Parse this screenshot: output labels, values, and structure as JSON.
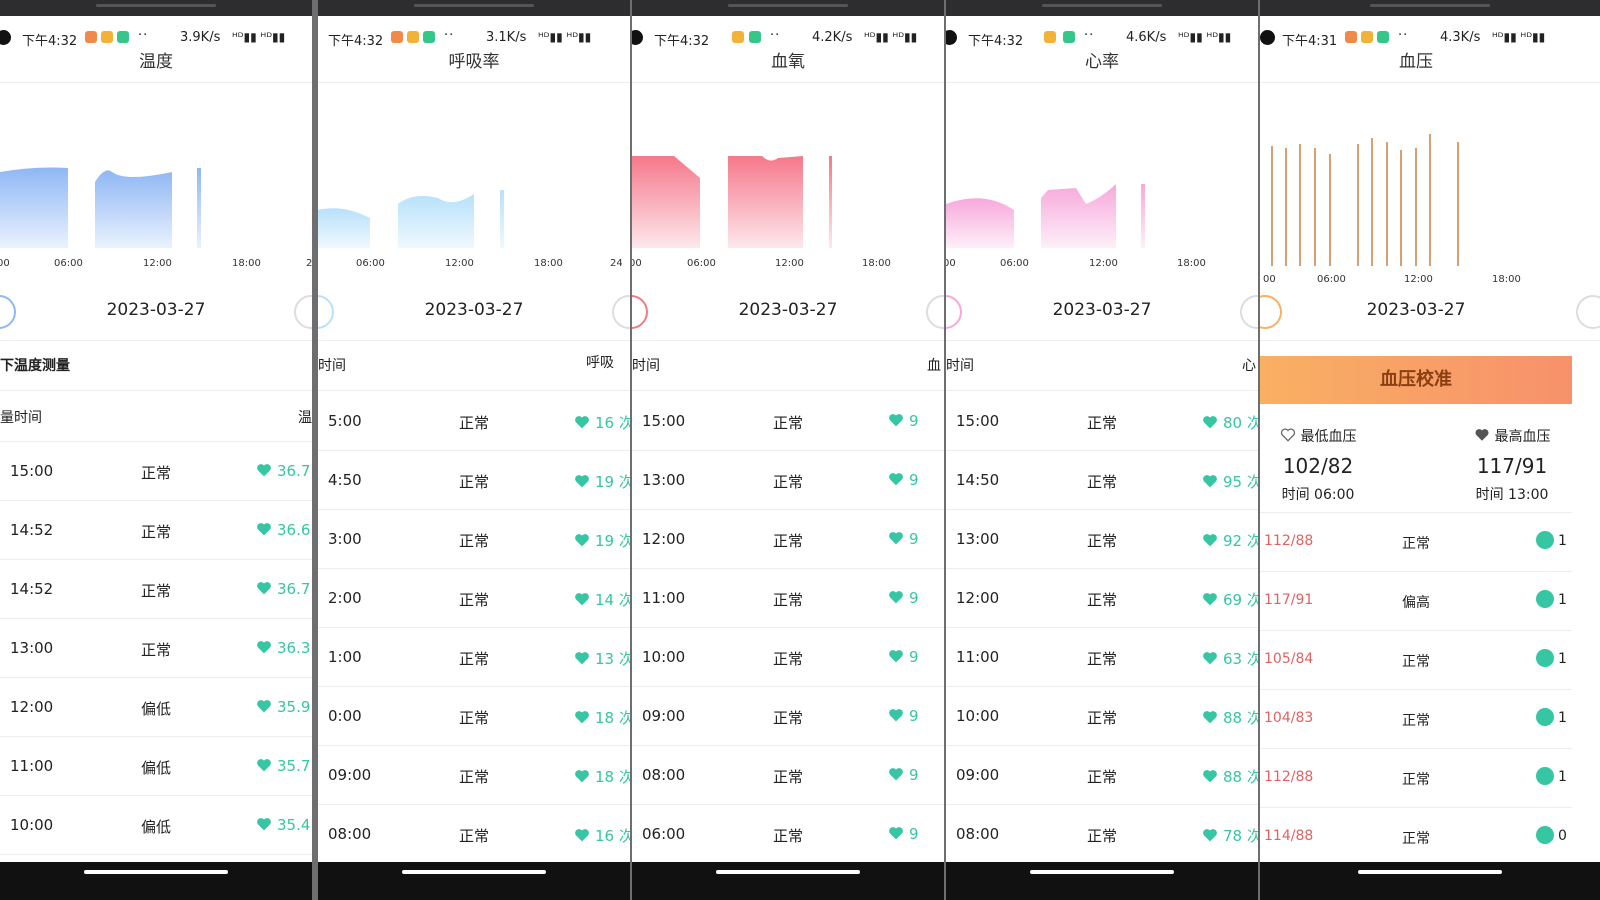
{
  "status": {
    "time": "下午4:32",
    "time_bp": "下午4:31",
    "dots": "··",
    "speeds": [
      "3.9K/s",
      "3.1K/s",
      "4.2K/s",
      "4.6K/s",
      "4.3K/s"
    ],
    "bt": "✱",
    "signal": "ᴴᴰ▮▮ ᴴᴰ▮▮"
  },
  "date": "2023-03-27",
  "xaxis": [
    "00",
    "06:00",
    "12:00",
    "18:00",
    "24"
  ],
  "heart_color": "#36c6a3",
  "temperature": {
    "title": "温度",
    "section_title": "下温度测量",
    "col_time": "量时间",
    "col_value": "温",
    "rows": [
      {
        "time": "15:00",
        "status": "正常",
        "value": "36.7"
      },
      {
        "time": "14:52",
        "status": "正常",
        "value": "36.6"
      },
      {
        "time": "14:52",
        "status": "正常",
        "value": "36.7"
      },
      {
        "time": "13:00",
        "status": "正常",
        "value": "36.3"
      },
      {
        "time": "12:00",
        "status": "偏低",
        "value": "35.9"
      },
      {
        "time": "11:00",
        "status": "偏低",
        "value": "35.7"
      },
      {
        "time": "10:00",
        "status": "偏低",
        "value": "35.4"
      }
    ]
  },
  "respiration": {
    "title": "呼吸率",
    "col_time": "时间",
    "col_value": "呼吸",
    "rows": [
      {
        "time": "5:00",
        "status": "正常",
        "value": "16 次/"
      },
      {
        "time": "4:50",
        "status": "正常",
        "value": "19 次/"
      },
      {
        "time": "3:00",
        "status": "正常",
        "value": "19 次/"
      },
      {
        "time": "2:00",
        "status": "正常",
        "value": "14 次/"
      },
      {
        "time": "1:00",
        "status": "正常",
        "value": "13 次/"
      },
      {
        "time": "0:00",
        "status": "正常",
        "value": "18 次/"
      },
      {
        "time": "09:00",
        "status": "正常",
        "value": "18 次/"
      },
      {
        "time": "08:00",
        "status": "正常",
        "value": "16 次/"
      }
    ]
  },
  "oxygen": {
    "title": "血氧",
    "col_time": "时间",
    "col_value": "血",
    "rows": [
      {
        "time": "15:00",
        "status": "正常",
        "value": "9"
      },
      {
        "time": "13:00",
        "status": "正常",
        "value": "9"
      },
      {
        "time": "12:00",
        "status": "正常",
        "value": "9"
      },
      {
        "time": "11:00",
        "status": "正常",
        "value": "9"
      },
      {
        "time": "10:00",
        "status": "正常",
        "value": "9"
      },
      {
        "time": "09:00",
        "status": "正常",
        "value": "9"
      },
      {
        "time": "08:00",
        "status": "正常",
        "value": "9"
      },
      {
        "time": "06:00",
        "status": "正常",
        "value": "9"
      }
    ]
  },
  "heartrate": {
    "title": "心率",
    "col_time": "时间",
    "col_value": "心",
    "rows": [
      {
        "time": "15:00",
        "status": "正常",
        "value": "80 次"
      },
      {
        "time": "14:50",
        "status": "正常",
        "value": "95 次"
      },
      {
        "time": "13:00",
        "status": "正常",
        "value": "92 次"
      },
      {
        "time": "12:00",
        "status": "正常",
        "value": "69 次"
      },
      {
        "time": "11:00",
        "status": "正常",
        "value": "63 次"
      },
      {
        "time": "10:00",
        "status": "正常",
        "value": "88 次"
      },
      {
        "time": "09:00",
        "status": "正常",
        "value": "88 次"
      },
      {
        "time": "08:00",
        "status": "正常",
        "value": "78 次"
      }
    ]
  },
  "bloodpressure": {
    "title": "血压",
    "banner": "血压校准",
    "min_label": "最低血压",
    "min_value": "102/82",
    "min_time": "时间 06:00",
    "max_label": "最高血压",
    "max_value": "117/91",
    "max_time": "时间 13:00",
    "rows": [
      {
        "value": "112/88",
        "status": "正常",
        "tail": "1"
      },
      {
        "value": "117/91",
        "status": "偏高",
        "tail": "1"
      },
      {
        "value": "105/84",
        "status": "正常",
        "tail": "1"
      },
      {
        "value": "104/83",
        "status": "正常",
        "tail": "1"
      },
      {
        "value": "112/88",
        "status": "正常",
        "tail": "1"
      },
      {
        "value": "114/88",
        "status": "正常",
        "tail": "0"
      }
    ]
  }
}
